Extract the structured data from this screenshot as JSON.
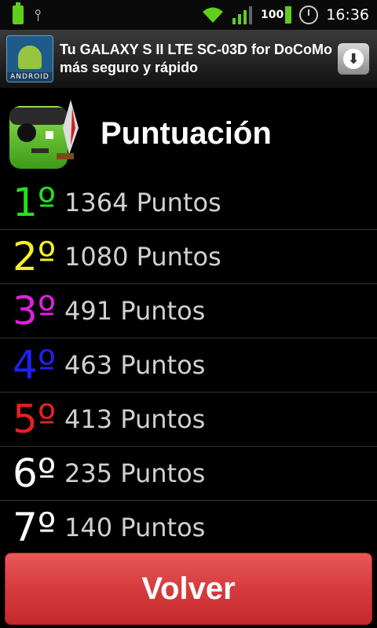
{
  "status_bar": {
    "battery_label": "100",
    "time": "16:36",
    "icons": [
      "battery-icon",
      "usb-icon",
      "wifi-icon",
      "signal-icon",
      "alarm-icon"
    ]
  },
  "ad": {
    "logo_text": "ANDROID",
    "text": "Tu GALAXY S II LTE SC-03D for DoCoMo más seguro y rápido",
    "download_icon": "download-icon"
  },
  "header": {
    "title": "Puntuación"
  },
  "scores": [
    {
      "rank": "1º",
      "points": "1364 Puntos",
      "color": "#22e022"
    },
    {
      "rank": "2º",
      "points": "1080 Puntos",
      "color": "#f2f222"
    },
    {
      "rank": "3º",
      "points": "491 Puntos",
      "color": "#e020e0"
    },
    {
      "rank": "4º",
      "points": "463 Puntos",
      "color": "#2020f0"
    },
    {
      "rank": "5º",
      "points": "413 Puntos",
      "color": "#e82020"
    },
    {
      "rank": "6º",
      "points": "235 Puntos",
      "color": "#ffffff"
    },
    {
      "rank": "7º",
      "points": "140 Puntos",
      "color": "#ffffff"
    }
  ],
  "footer": {
    "volver_label": "Volver",
    "button_color": "#d63b3d"
  }
}
